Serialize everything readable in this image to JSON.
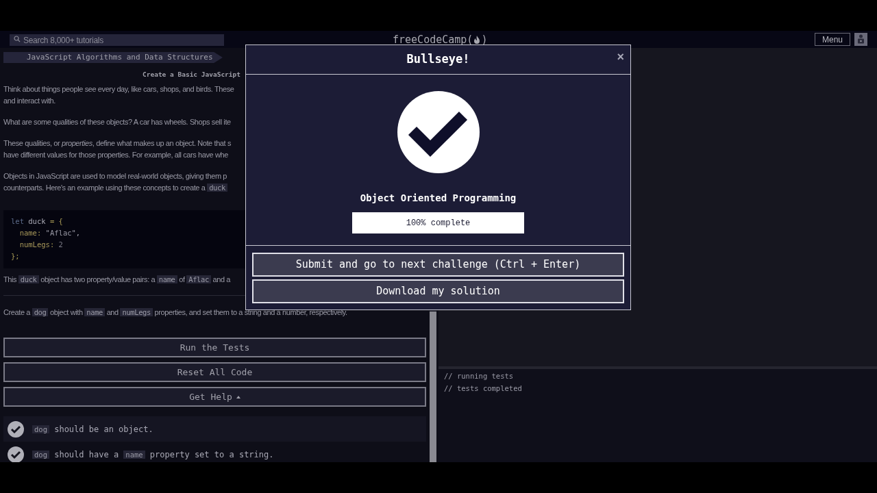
{
  "navbar": {
    "search": {
      "placeholder": "Search 8,000+ tutorials"
    },
    "logo": {
      "before": "freeCodeCamp(",
      "after": ")"
    },
    "menu_button": "Menu"
  },
  "breadcrumb": [
    {
      "label": "JavaScript Algorithms and Data Structures"
    }
  ],
  "challenge_title": "Create a Basic JavaScript",
  "description": [
    {
      "kind": "paragraph",
      "lines": [
        [
          {
            "kind": "text",
            "text": "Think about things people see every day, like cars, shops, and birds. These"
          }
        ],
        [
          {
            "kind": "text",
            "text": "and interact with."
          }
        ]
      ]
    },
    {
      "kind": "paragraph",
      "lines": [
        [
          {
            "kind": "text",
            "text": "What are some qualities of these objects? A car has wheels. Shops sell ite"
          }
        ]
      ]
    },
    {
      "kind": "paragraph",
      "lines": [
        [
          {
            "kind": "text",
            "text": "These qualities, or *properties*, define what makes up an object. Note that s"
          }
        ],
        [
          {
            "kind": "text",
            "text": "have different values for those properties. For example, all cars have whe"
          }
        ]
      ]
    },
    {
      "kind": "paragraph",
      "lines": [
        [
          {
            "kind": "text",
            "text": "Objects in JavaScript are used to model real-world objects, giving them p"
          }
        ],
        [
          {
            "kind": "text",
            "text": "counterparts. Here's an example using these concepts to create a "
          },
          {
            "kind": "code",
            "text": "duck"
          }
        ]
      ]
    },
    {
      "kind": "code_block",
      "lines": [
        [
          {
            "kind": "keyword",
            "text": "let "
          },
          {
            "kind": "plain",
            "text": "duck "
          },
          {
            "kind": "punct",
            "text": "= {"
          }
        ],
        [
          {
            "kind": "property",
            "text": "  name"
          },
          {
            "kind": "punct",
            "text": ": "
          },
          {
            "kind": "string",
            "text": "\"Aflac\""
          },
          {
            "kind": "plain",
            "text": ","
          }
        ],
        [
          {
            "kind": "property",
            "text": "  numLegs"
          },
          {
            "kind": "punct",
            "text": ": "
          },
          {
            "kind": "number",
            "text": "2"
          }
        ],
        [
          {
            "kind": "punct",
            "text": "};"
          }
        ]
      ]
    },
    {
      "kind": "paragraph",
      "lines": [
        [
          {
            "kind": "text",
            "text": "This "
          },
          {
            "kind": "code",
            "text": "duck"
          },
          {
            "kind": "text",
            "text": " object has two property/value pairs: a "
          },
          {
            "kind": "code",
            "text": "name"
          },
          {
            "kind": "text",
            "text": " of "
          },
          {
            "kind": "code",
            "text": "Aflac"
          },
          {
            "kind": "text",
            "text": " and a"
          }
        ]
      ]
    },
    {
      "kind": "rule"
    },
    {
      "kind": "paragraph",
      "lines": [
        [
          {
            "kind": "text",
            "text": "Create a "
          },
          {
            "kind": "code",
            "text": "dog"
          },
          {
            "kind": "text",
            "text": " object with "
          },
          {
            "kind": "code",
            "text": "name"
          },
          {
            "kind": "text",
            "text": " and "
          },
          {
            "kind": "code",
            "text": "numLegs"
          },
          {
            "kind": "text",
            "text": " properties, and set them to a string and a number, respectively."
          }
        ]
      ]
    }
  ],
  "buttons": [
    {
      "label": "Run the Tests",
      "kind": "plain"
    },
    {
      "label": "Reset All Code",
      "kind": "plain"
    },
    {
      "label": "Get Help",
      "kind": "dropdown"
    }
  ],
  "tests": [
    {
      "passed": true,
      "segments": [
        {
          "kind": "code",
          "text": "dog"
        },
        {
          "kind": "text",
          "text": " should be an object."
        }
      ]
    },
    {
      "passed": true,
      "segments": [
        {
          "kind": "code",
          "text": "dog"
        },
        {
          "kind": "text",
          "text": " should have a "
        },
        {
          "kind": "code",
          "text": "name"
        },
        {
          "kind": "text",
          "text": " property set to a string."
        }
      ]
    }
  ],
  "console": {
    "lines": [
      "// running tests",
      "// tests completed"
    ]
  },
  "modal": {
    "title": "Bullseye!",
    "close": "×",
    "subtitle": "Object Oriented Programming",
    "progress": {
      "level": 1,
      "label": "100% complete"
    },
    "buttons": [
      "Submit and go to next challenge (Ctrl + Enter)",
      "Download my solution"
    ]
  }
}
